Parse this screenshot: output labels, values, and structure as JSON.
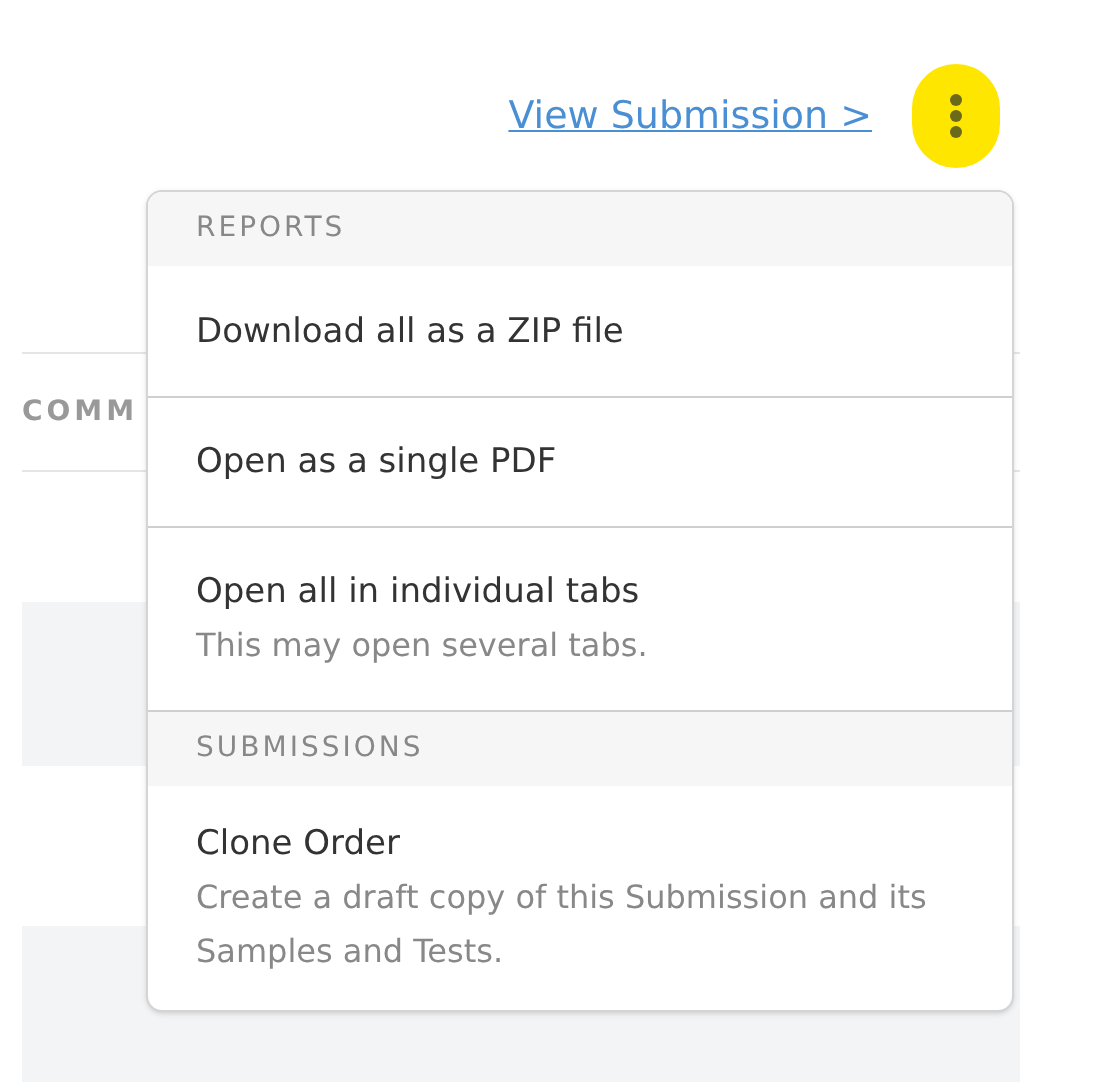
{
  "header": {
    "link": "View Submission >"
  },
  "table": {
    "column_1": "COMM"
  },
  "menu": {
    "sections": [
      {
        "title": "REPORTS",
        "items": [
          {
            "label": "Download all as a ZIP file"
          },
          {
            "label": "Open as a single PDF"
          },
          {
            "label": "Open all in individual tabs",
            "description": "This may open several tabs."
          }
        ]
      },
      {
        "title": "SUBMISSIONS",
        "items": [
          {
            "label": "Clone Order",
            "description": "Create a draft copy of this Submission and its Samples and Tests."
          }
        ]
      }
    ]
  }
}
